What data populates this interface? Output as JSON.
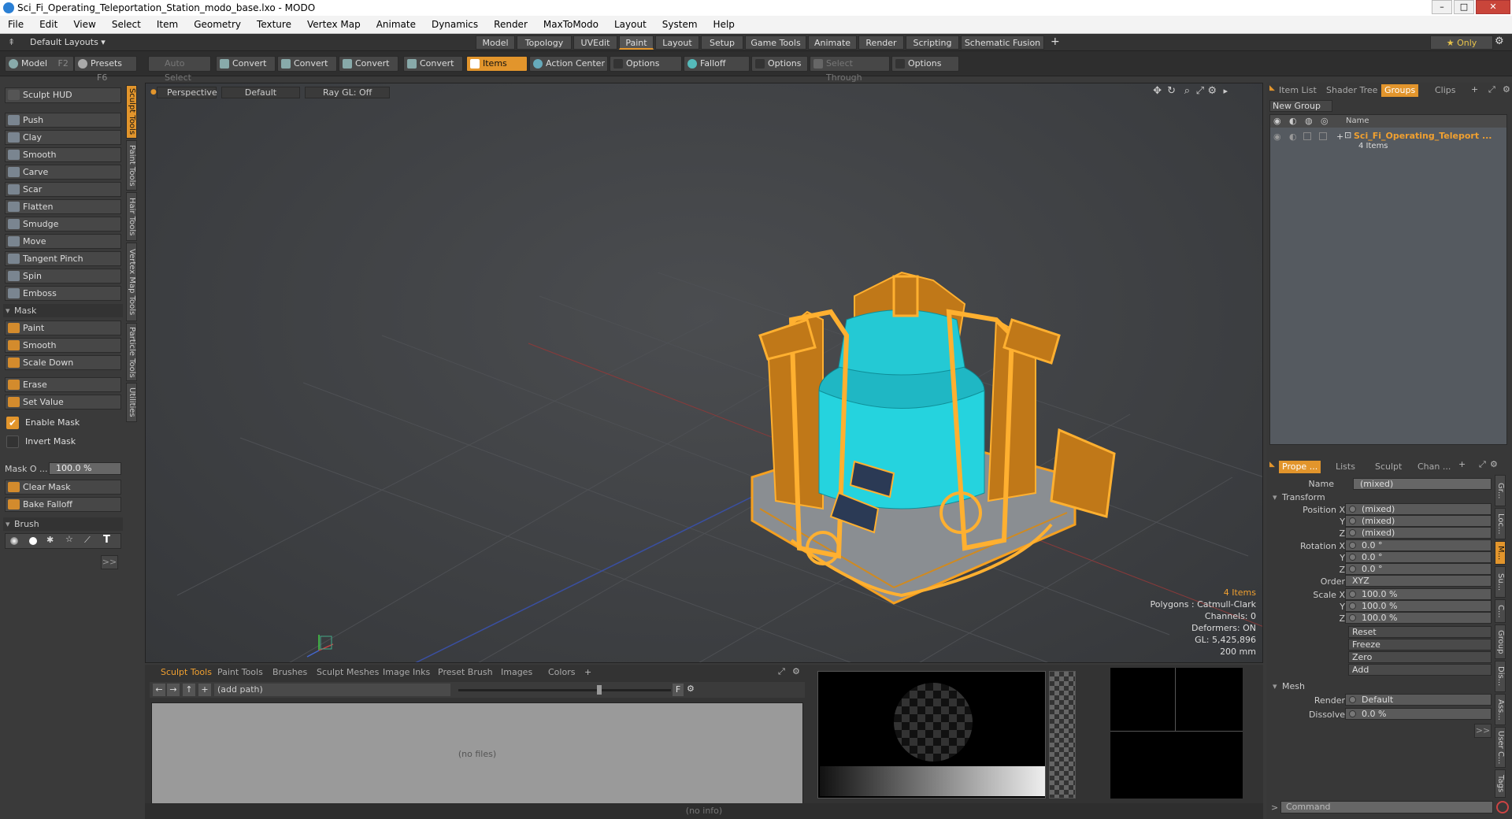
{
  "window": {
    "title": "Sci_Fi_Operating_Teleportation_Station_modo_base.lxo - MODO"
  },
  "menu": [
    "File",
    "Edit",
    "View",
    "Select",
    "Item",
    "Geometry",
    "Texture",
    "Vertex Map",
    "Animate",
    "Dynamics",
    "Render",
    "MaxToModo",
    "Layout",
    "System",
    "Help"
  ],
  "layout_bar": {
    "default_layouts": "Default Layouts ▾",
    "tabs": [
      "Model",
      "Topology",
      "UVEdit",
      "Paint",
      "Layout",
      "Setup",
      "Game Tools",
      "Animate",
      "Render",
      "Scripting",
      "Schematic Fusion"
    ],
    "active_tab": "Paint",
    "only": "★  Only"
  },
  "toolbar": {
    "model": "Model",
    "model_key": "F2",
    "presets": "Presets",
    "presets_key": "F6",
    "auto_select": "Auto Select",
    "convert1": "Convert",
    "convert2": "Convert",
    "convert3": "Convert",
    "convert4": "Convert",
    "items": "Items",
    "action_center": "Action Center",
    "options1": "Options",
    "falloff": "Falloff",
    "options2": "Options",
    "select_through": "Select Through",
    "options3": "Options"
  },
  "left": {
    "sculpt_hud": "Sculpt HUD",
    "tools": [
      "Push",
      "Clay",
      "Smooth",
      "Carve",
      "Scar",
      "Flatten",
      "Smudge",
      "Move",
      "Tangent Pinch",
      "Spin",
      "Emboss"
    ],
    "mask_header": "Mask",
    "mask_tools": [
      "Paint",
      "Smooth",
      "Scale Down"
    ],
    "erase": "Erase",
    "set_value": "Set Value",
    "enable_mask": "Enable Mask",
    "invert_mask": "Invert Mask",
    "mask_opacity_label": "Mask O ...",
    "mask_opacity_value": "100.0 %",
    "clear_mask": "Clear Mask",
    "bake_falloff": "Bake Falloff",
    "brush_header": "Brush",
    "brush_text_glyph": "T",
    "more": ">>",
    "vtabs": [
      "Sculpt Tools",
      "Paint Tools",
      "Hair Tools",
      "Vertex Map Tools",
      "Particle Tools",
      "Utilities"
    ]
  },
  "viewport": {
    "perspective": "Perspective",
    "default": "Default",
    "raygl": "Ray GL: Off",
    "info": {
      "items": "4 Items",
      "polygons": "Polygons : Catmull-Clark",
      "channels": "Channels: 0",
      "deformers": "Deformers: ON",
      "gl": "GL: 5,425,896",
      "scale": "200 mm"
    }
  },
  "bottom": {
    "tabs": [
      "Sculpt Tools",
      "Paint Tools",
      "Brushes",
      "Sculpt Meshes",
      "Image Inks",
      "Preset Brush",
      "Images",
      "Colors"
    ],
    "active": "Sculpt Tools",
    "path": "(add path)",
    "no_files": "(no files)",
    "f_btn": "F",
    "status": "(no info)"
  },
  "right": {
    "top_tabs": [
      "Item List",
      "Shader Tree",
      "Groups",
      "Clips"
    ],
    "active_top": "Groups",
    "new_group": "New Group",
    "name_col": "Name",
    "group_name": "Sci_Fi_Operating_Teleport ...",
    "group_items": "4 Items",
    "prop_tabs": [
      "Prope ...",
      "Lists",
      "Sculpt",
      "Chan ..."
    ],
    "active_prop": "Prope ...",
    "name_label": "Name",
    "name_value": "(mixed)",
    "transform": "Transform",
    "pos_x_label": "Position X",
    "y_label": "Y",
    "z_label": "Z",
    "pos_x": "(mixed)",
    "pos_y": "(mixed)",
    "pos_z": "(mixed)",
    "rot_x_label": "Rotation X",
    "rot_x": "0.0 °",
    "rot_y": "0.0 °",
    "rot_z": "0.0 °",
    "order_label": "Order",
    "order": "XYZ",
    "scale_x_label": "Scale X",
    "scale_x": "100.0 %",
    "scale_y": "100.0 %",
    "scale_z": "100.0 %",
    "reset": "Reset",
    "freeze": "Freeze",
    "zero": "Zero",
    "add": "Add",
    "mesh": "Mesh",
    "render_label": "Render",
    "render": "Default",
    "dissolve_label": "Dissolve",
    "dissolve": "0.0 %",
    "more": ">>",
    "command": "Command",
    "side_tabs": [
      "Gr...",
      "Loc...",
      "M...",
      "Su...",
      "C...",
      "Group",
      "Dis...",
      "Ass...",
      "User C...",
      "Tags"
    ]
  }
}
